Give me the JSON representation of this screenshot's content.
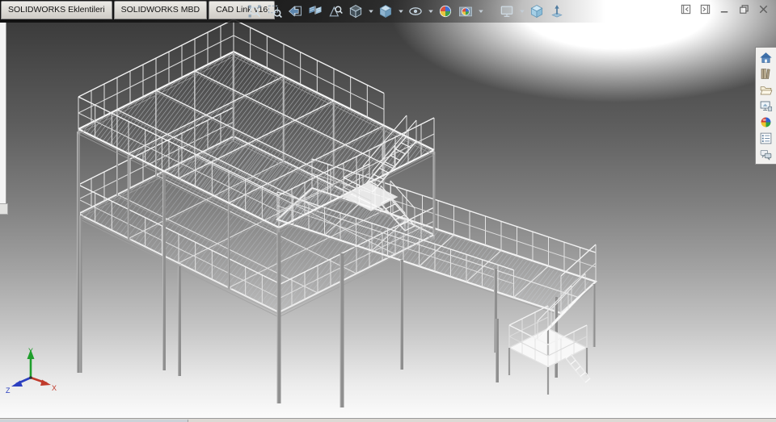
{
  "tabs": [
    {
      "label": "SOLIDWORKS Eklentileri"
    },
    {
      "label": "SOLIDWORKS MBD"
    },
    {
      "label": "CAD Link v16"
    }
  ],
  "toolbar": {
    "items": [
      {
        "icon": "zoom-to-fit"
      },
      {
        "icon": "zoom-to-area"
      },
      {
        "icon": "previous-view"
      },
      {
        "icon": "section-view"
      },
      {
        "icon": "annotation-view"
      },
      {
        "icon": "view-orientation",
        "caret": true
      },
      {
        "icon": "display-style",
        "caret": true
      },
      {
        "icon": "hide-show-items",
        "caret": true
      },
      {
        "icon": "edit-appearance"
      },
      {
        "icon": "apply-scene",
        "caret": true
      },
      {
        "icon": "view-settings",
        "caret": true,
        "gap_before": true
      },
      {
        "icon": "view-cube"
      },
      {
        "icon": "rotate-view"
      }
    ]
  },
  "window_controls": [
    {
      "icon": "collapse-left"
    },
    {
      "icon": "collapse-right"
    },
    {
      "icon": "minimize"
    },
    {
      "icon": "restore"
    },
    {
      "icon": "close"
    }
  ],
  "taskpane": {
    "items": [
      {
        "icon": "solidworks-resources"
      },
      {
        "icon": "design-library"
      },
      {
        "icon": "file-explorer"
      },
      {
        "icon": "view-palette"
      },
      {
        "icon": "appearances-scenes-decals"
      },
      {
        "icon": "custom-properties"
      },
      {
        "icon": "solidworks-forum"
      }
    ]
  },
  "viewport": {
    "triad": {
      "x_label": "X",
      "y_label": "Y",
      "z_label": "Z",
      "x_color": "#c03a2b",
      "y_color": "#1f9e2c",
      "z_color": "#2b3fc0"
    },
    "glow_color": "#ffffff",
    "background_top": "#343434",
    "background_bottom": "#fdfdfd"
  },
  "statusbar": {
    "text": ""
  },
  "colors": {
    "tab_bg": "#d9d6d1",
    "tab_text": "#141414",
    "chrome_border": "#8a8a8a"
  }
}
